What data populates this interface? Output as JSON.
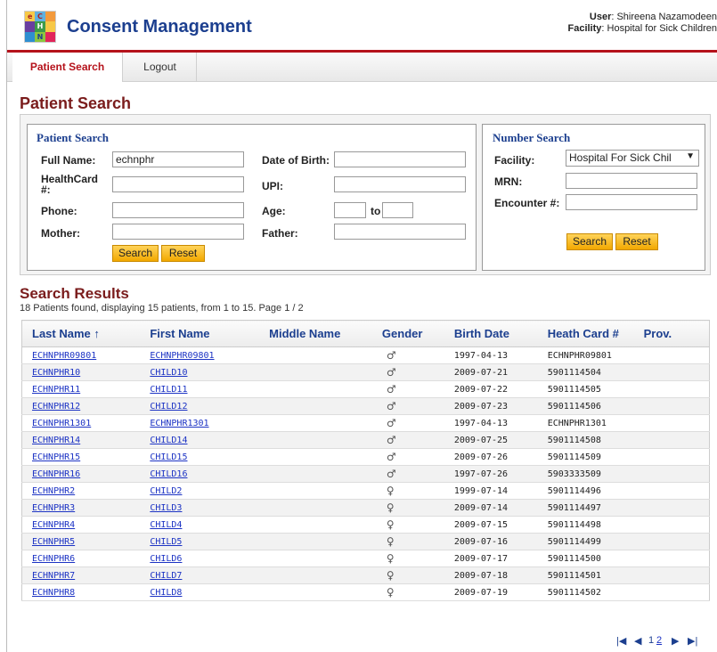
{
  "app": {
    "title": "Consent Management",
    "logo_letters": [
      "e",
      "C",
      "",
      "",
      "H",
      "",
      "",
      "N",
      ""
    ],
    "user_label": "User",
    "user_value": ": Shireena Nazamodeen",
    "facility_label": "Facility",
    "facility_value": ": Hospital for Sick Children"
  },
  "nav": {
    "tabs": [
      "Patient Search",
      "Logout"
    ]
  },
  "page_title": "Patient Search",
  "patient_search": {
    "title": "Patient Search",
    "full_name_label": "Full Name:",
    "full_name_value": "echnphr",
    "healthcard_label": "HealthCard #:",
    "phone_label": "Phone:",
    "mother_label": "Mother:",
    "dob_label": "Date of Birth:",
    "upi_label": "UPI:",
    "age_label": "Age:",
    "age_to": "to",
    "father_label": "Father:",
    "search_button": "Search",
    "reset_button": "Reset"
  },
  "number_search": {
    "title": "Number Search",
    "facility_label": "Facility:",
    "facility_value": "Hospital For Sick Chil",
    "mrn_label": "MRN:",
    "encounter_label": "Encounter #:",
    "search_button": "Search",
    "reset_button": "Reset"
  },
  "results": {
    "title": "Search Results",
    "summary": "18 Patients found, displaying 15 patients, from 1 to 15. Page 1 / 2",
    "columns": [
      "Last Name ↑",
      "First Name",
      "Middle Name",
      "Gender",
      "Birth Date",
      "Heath Card #",
      "Prov."
    ],
    "rows": [
      {
        "last": "ECHNPHR09801",
        "first": "ECHNPHR09801",
        "middle": "",
        "gender": "♂",
        "birth": "1997-04-13",
        "card": "ECHNPHR09801",
        "prov": ""
      },
      {
        "last": "ECHNPHR10",
        "first": "CHILD10",
        "middle": "",
        "gender": "♂",
        "birth": "2009-07-21",
        "card": "5901114504",
        "prov": ""
      },
      {
        "last": "ECHNPHR11",
        "first": "CHILD11",
        "middle": "",
        "gender": "♂",
        "birth": "2009-07-22",
        "card": "5901114505",
        "prov": ""
      },
      {
        "last": "ECHNPHR12",
        "first": "CHILD12",
        "middle": "",
        "gender": "♂",
        "birth": "2009-07-23",
        "card": "5901114506",
        "prov": ""
      },
      {
        "last": "ECHNPHR1301",
        "first": "ECHNPHR1301",
        "middle": "",
        "gender": "♂",
        "birth": "1997-04-13",
        "card": "ECHNPHR1301",
        "prov": ""
      },
      {
        "last": "ECHNPHR14",
        "first": "CHILD14",
        "middle": "",
        "gender": "♂",
        "birth": "2009-07-25",
        "card": "5901114508",
        "prov": ""
      },
      {
        "last": "ECHNPHR15",
        "first": "CHILD15",
        "middle": "",
        "gender": "♂",
        "birth": "2009-07-26",
        "card": "5901114509",
        "prov": ""
      },
      {
        "last": "ECHNPHR16",
        "first": "CHILD16",
        "middle": "",
        "gender": "♂",
        "birth": "1997-07-26",
        "card": "5903333509",
        "prov": ""
      },
      {
        "last": "ECHNPHR2",
        "first": "CHILD2",
        "middle": "",
        "gender": "♀",
        "birth": "1999-07-14",
        "card": "5901114496",
        "prov": ""
      },
      {
        "last": "ECHNPHR3",
        "first": "CHILD3",
        "middle": "",
        "gender": "♀",
        "birth": "2009-07-14",
        "card": "5901114497",
        "prov": ""
      },
      {
        "last": "ECHNPHR4",
        "first": "CHILD4",
        "middle": "",
        "gender": "♀",
        "birth": "2009-07-15",
        "card": "5901114498",
        "prov": ""
      },
      {
        "last": "ECHNPHR5",
        "first": "CHILD5",
        "middle": "",
        "gender": "♀",
        "birth": "2009-07-16",
        "card": "5901114499",
        "prov": ""
      },
      {
        "last": "ECHNPHR6",
        "first": "CHILD6",
        "middle": "",
        "gender": "♀",
        "birth": "2009-07-17",
        "card": "5901114500",
        "prov": ""
      },
      {
        "last": "ECHNPHR7",
        "first": "CHILD7",
        "middle": "",
        "gender": "♀",
        "birth": "2009-07-18",
        "card": "5901114501",
        "prov": ""
      },
      {
        "last": "ECHNPHR8",
        "first": "CHILD8",
        "middle": "",
        "gender": "♀",
        "birth": "2009-07-19",
        "card": "5901114502",
        "prov": ""
      }
    ]
  },
  "pager": {
    "first_icon": "first-page-icon",
    "prev_icon": "prev-page-icon",
    "page1": "1",
    "page2": "2",
    "next_icon": "next-page-icon",
    "last_icon": "last-page-icon"
  },
  "colors": {
    "brand_blue": "#1c3f8f",
    "brand_red": "#b5121b",
    "button_orange": "#f2a800",
    "link_blue": "#1c33c4"
  }
}
